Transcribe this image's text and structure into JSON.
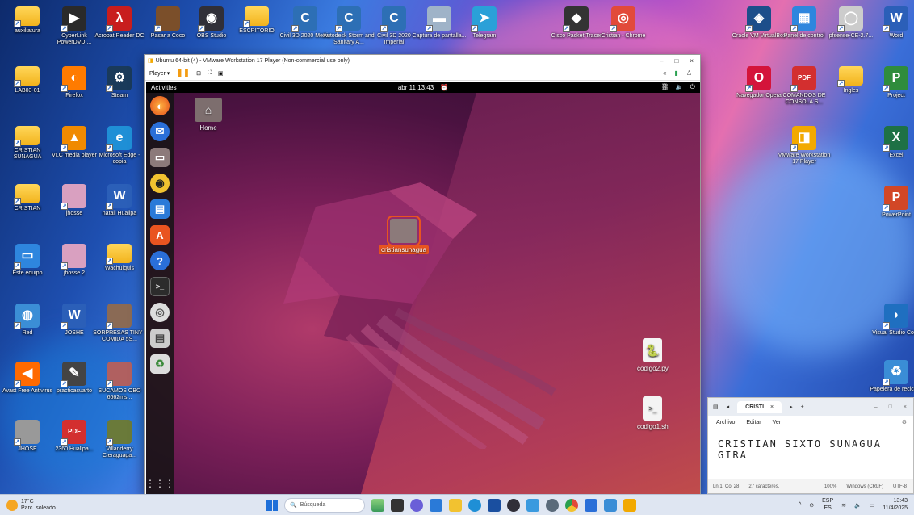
{
  "desktop_left": [
    {
      "label": "auxiliatura",
      "glyph": "",
      "kind": "folder"
    },
    {
      "label": "CyberLink PowerDVD ...",
      "glyph": "▶",
      "color": "#2a2a2a"
    },
    {
      "label": "Acrobat Reader DC",
      "glyph": "λ",
      "color": "#c81d1d"
    },
    {
      "label": "Pasar a Coco",
      "glyph": "",
      "color": "#7b4f2a"
    },
    {
      "label": "OBS Studio",
      "glyph": "◉",
      "color": "#302f38"
    },
    {
      "label": "ESCRITORIO",
      "glyph": "",
      "kind": "folder"
    },
    {
      "label": "LAB03-01",
      "glyph": "",
      "kind": "folder"
    },
    {
      "label": "Firefox",
      "glyph": "◐",
      "color": "#ff7b00"
    },
    {
      "label": "Steam",
      "glyph": "⚙",
      "color": "#1a3a5a"
    },
    {
      "label": "CRISTIAN SUNAGUA",
      "glyph": "",
      "kind": "folder"
    },
    {
      "label": "VLC media player",
      "glyph": "▲",
      "color": "#f08a00"
    },
    {
      "label": "Microsoft Edge - copia",
      "glyph": "e",
      "color": "#1f8fd6"
    },
    {
      "label": "CRISTIAN",
      "glyph": "",
      "kind": "folder"
    },
    {
      "label": "jhosse",
      "glyph": "",
      "color": "#d9a0c0"
    },
    {
      "label": "natali Huallpa",
      "glyph": "W",
      "color": "#2b5fb8"
    },
    {
      "label": "Este equipo",
      "glyph": "▭",
      "color": "#2e86de"
    },
    {
      "label": "jhosse 2",
      "glyph": "",
      "color": "#d9a0c0"
    },
    {
      "label": "Wachuiquis",
      "glyph": "",
      "kind": "folder"
    },
    {
      "label": "Red",
      "glyph": "◍",
      "color": "#3b8ed6"
    },
    {
      "label": "JOSHE",
      "glyph": "W",
      "color": "#2b5fb8"
    },
    {
      "label": "SORPRESAS TINY - COMIDA 5S...",
      "glyph": "",
      "color": "#8a6a55"
    },
    {
      "label": "Avast Free Antivirus",
      "glyph": "◀",
      "color": "#ff6a00"
    },
    {
      "label": "practicacuarto",
      "glyph": "✎",
      "color": "#444"
    },
    {
      "label": "SUCAMOS OBO 6662ms...",
      "glyph": "",
      "color": "#b06060"
    },
    {
      "label": "JHOSE",
      "glyph": "",
      "color": "#999"
    },
    {
      "label": "2360 Huallpa...",
      "glyph": "PDF",
      "color": "#d32f2f"
    },
    {
      "label": "Villanderry Cieraguaga...",
      "glyph": "",
      "color": "#6a7a3a"
    }
  ],
  "desktop_top": [
    {
      "label": "Civil 3D 2020 Metric",
      "glyph": "C",
      "color": "#2d6fb5"
    },
    {
      "label": "Autodesk Storm and Sanitary A...",
      "glyph": "C",
      "color": "#2d6fb5"
    },
    {
      "label": "Civil 3D 2020 Imperial",
      "glyph": "C",
      "color": "#2d6fb5"
    },
    {
      "label": "Captura de pantalla...",
      "glyph": "▬",
      "color": "#9fb3c8"
    },
    {
      "label": "Telegram",
      "glyph": "➤",
      "color": "#2aa0d8"
    },
    {
      "label": "Cisco Packet Tracer",
      "glyph": "◆",
      "color": "#333"
    },
    {
      "label": "Cristian - Chrome",
      "glyph": "◎",
      "color": "#e24a3a"
    }
  ],
  "desktop_right": [
    {
      "label": "Oracle VM VirtualBox",
      "glyph": "◈",
      "color": "#1c4e8a"
    },
    {
      "label": "Panel de control",
      "glyph": "▦",
      "color": "#2e86de"
    },
    {
      "label": "pfsense-CE-2.7...",
      "glyph": "◯",
      "color": "#ccc"
    },
    {
      "label": "Word",
      "glyph": "W",
      "color": "#2b5fb8"
    },
    {
      "label": "Navegador Opera",
      "glyph": "O",
      "color": "#d4143a"
    },
    {
      "label": "COMANDOS DE CONSOLA S...",
      "glyph": "PDF",
      "color": "#d32f2f"
    },
    {
      "label": "Ingles",
      "glyph": "",
      "kind": "folder"
    },
    {
      "label": "Project",
      "glyph": "P",
      "color": "#2f8c3c"
    },
    {
      "label": "VMware Workstation 17 Player",
      "glyph": "◨",
      "color": "#f2a900"
    },
    {
      "label": "Excel",
      "glyph": "X",
      "color": "#1e7145"
    },
    {
      "label": "PowerPoint",
      "glyph": "P",
      "color": "#d24726"
    },
    {
      "label": "Visual Studio Code",
      "glyph": "◗",
      "color": "#1f6fc0"
    },
    {
      "label": "Papelera de reciclaje",
      "glyph": "♻",
      "color": "#3a8dd6"
    }
  ],
  "vmware": {
    "title": "Ubuntu 64-bit (4) - VMware Workstation 17 Player (Non-commercial use only)",
    "player_label": "Player ▾",
    "min": "–",
    "max": "□",
    "close": "×"
  },
  "ubuntu": {
    "activities": "Activities",
    "clock": "abr 11  13:43",
    "files": {
      "home": "Home",
      "selected_folder": "cristiansunagua",
      "python_file": "codigo2.py",
      "shell_file": "codigo1.sh"
    }
  },
  "notepad": {
    "tab_title": "CRISTI",
    "tab_close": "×",
    "new_tab": "+",
    "menu": [
      "Archivo",
      "Editar",
      "Ver"
    ],
    "content": "CRISTIAN SIXTO SUNAGUA GIRA",
    "status": {
      "position": "Ln 1, Col 28",
      "chars": "27 caracteres.",
      "zoom": "100%",
      "eol": "Windows (CRLF)",
      "encoding": "UTF-8"
    }
  },
  "taskbar": {
    "weather_temp": "17°C",
    "weather_desc": "Parc. soleado",
    "search_placeholder": "Búsqueda",
    "lang_top": "ESP",
    "lang_bottom": "ES",
    "time": "13:43",
    "date": "11/4/2025"
  }
}
